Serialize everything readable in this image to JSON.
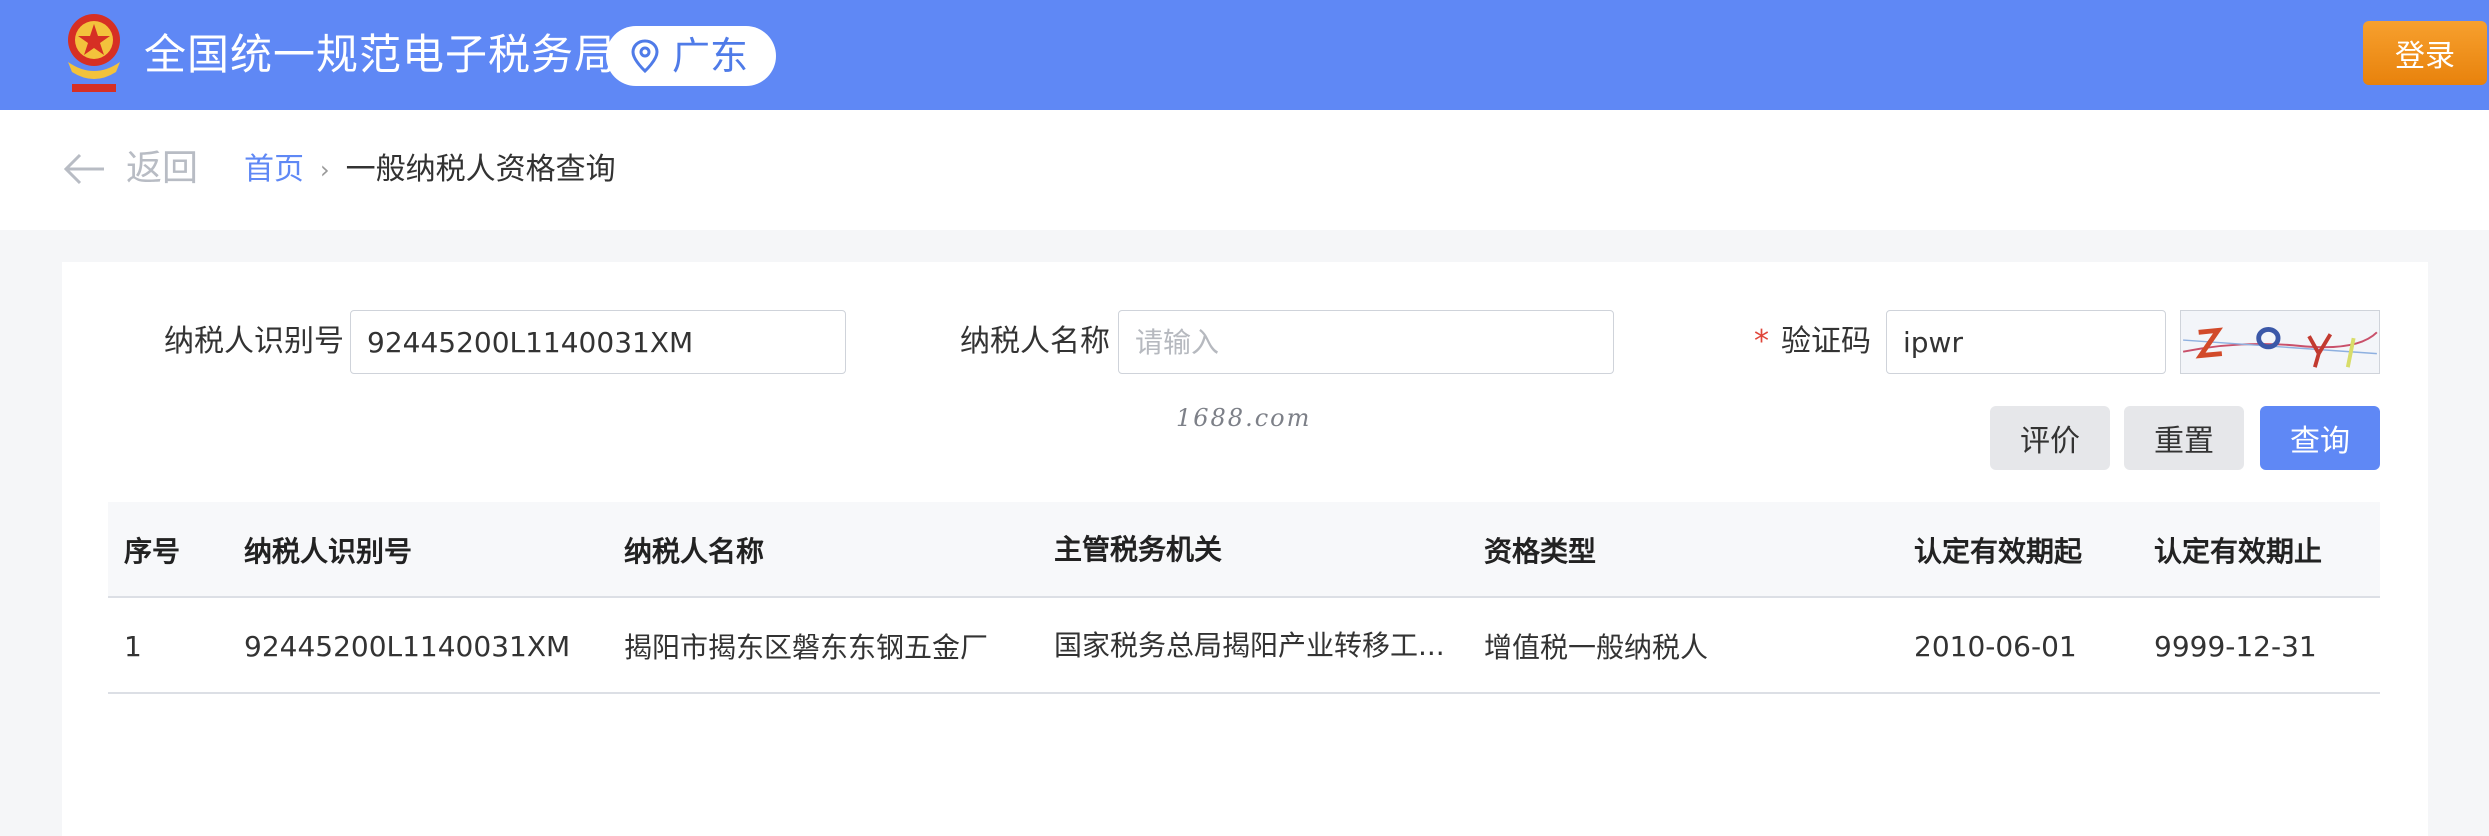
{
  "header": {
    "title": "全国统一规范电子税务局",
    "region": "广东",
    "login_label": "登录",
    "primary_color": "#5f88f5",
    "login_color": "#ee8c16"
  },
  "breadcrumb": {
    "back_label": "返回",
    "home": "首页",
    "separator": "›",
    "current": "一般纳税人资格查询"
  },
  "form": {
    "taxpayer_id_label": "纳税人识别号",
    "taxpayer_id_value": "92445200L1140031XM",
    "taxpayer_name_label": "纳税人名称",
    "taxpayer_name_placeholder": "请输入",
    "captcha_required_mark": "*",
    "captcha_label": "验证码",
    "captcha_value": "ipwr"
  },
  "watermark": "1688.com",
  "buttons": {
    "evaluate": "评价",
    "reset": "重置",
    "query": "查询"
  },
  "table": {
    "headers": [
      "序号",
      "纳税人识别号",
      "纳税人名称",
      "主管税务机关",
      "资格类型",
      "认定有效期起",
      "认定有效期止"
    ],
    "rows": [
      [
        "1",
        "92445200L1140031XM",
        "揭阳市揭东区磐东东钢五金厂",
        "国家税务总局揭阳产业转移工...",
        "增值税一般纳税人",
        "2010-06-01",
        "9999-12-31"
      ]
    ]
  }
}
